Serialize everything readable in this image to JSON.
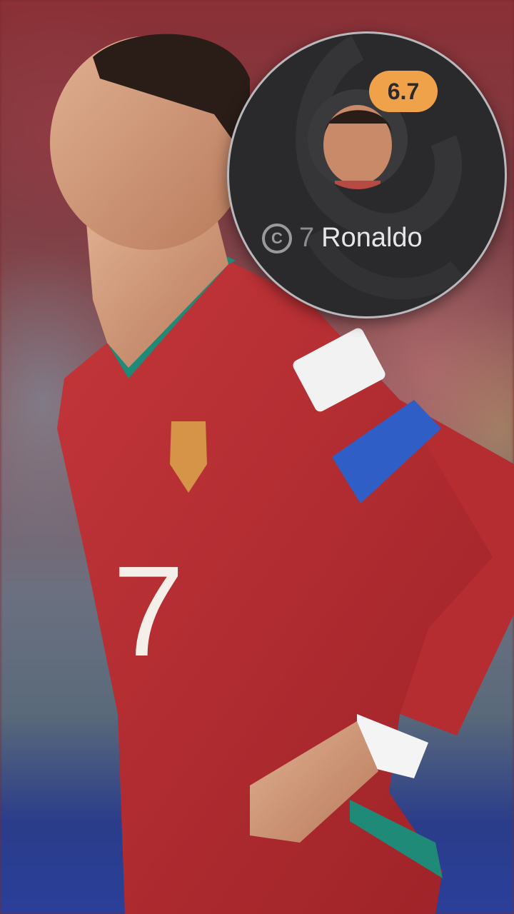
{
  "player_card": {
    "rating": "6.7",
    "captain_badge": "C",
    "shirt_number": "7",
    "name": "Ronaldo",
    "rating_color": "#f0a24a"
  },
  "photo": {
    "jersey_number": "7"
  }
}
